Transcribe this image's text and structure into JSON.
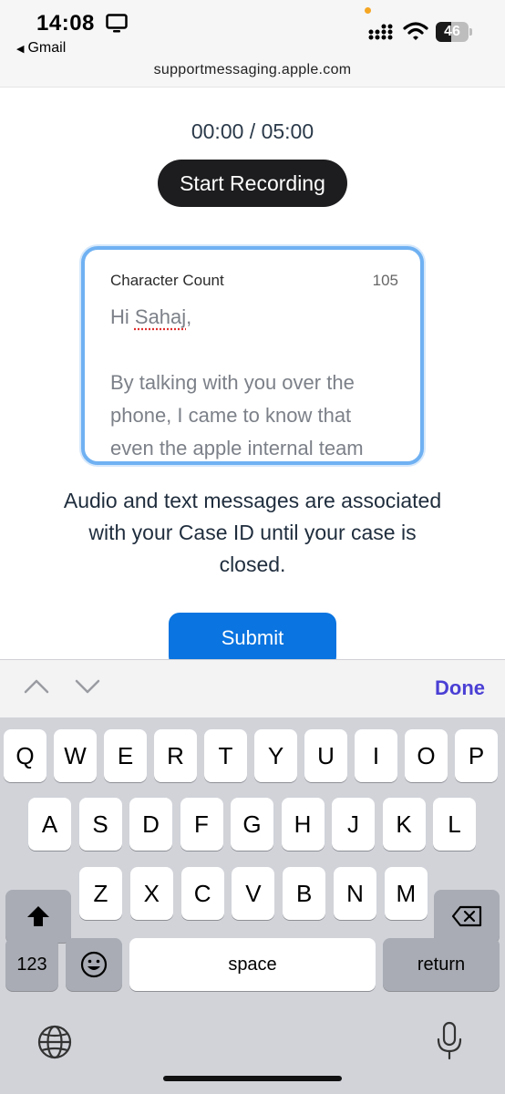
{
  "status_bar": {
    "time": "14:08",
    "back_app": "Gmail",
    "battery": "46",
    "battery_level": 0.46,
    "url": "supportmessaging.apple.com"
  },
  "recorder": {
    "timer": "00:00 / 05:00",
    "start_label": "Start Recording"
  },
  "message": {
    "char_label": "Character Count",
    "char_count": "105",
    "greeting_prefix": "Hi ",
    "greeting_name": "Sahaj",
    "greeting_suffix": ",",
    "body": "By talking with you over the phone, I came to know that even the apple internal team"
  },
  "notice": "Audio and text messages are associated with your Case ID until your case is closed.",
  "submit_label": "Submit",
  "accessory": {
    "done_label": "Done"
  },
  "keyboard": {
    "row1": [
      "Q",
      "W",
      "E",
      "R",
      "T",
      "Y",
      "U",
      "I",
      "O",
      "P"
    ],
    "row2": [
      "A",
      "S",
      "D",
      "F",
      "G",
      "H",
      "J",
      "K",
      "L"
    ],
    "row3": [
      "Z",
      "X",
      "C",
      "V",
      "B",
      "N",
      "M"
    ],
    "numbers_label": "123",
    "space_label": "space",
    "return_label": "return"
  },
  "icons": {
    "screen": "screen-mirror-icon",
    "signal": "cellular-signal-icon",
    "wifi": "wifi-icon",
    "shift": "shift-icon",
    "delete": "delete-icon",
    "emoji": "emoji-icon",
    "globe": "globe-icon",
    "mic": "microphone-icon"
  }
}
